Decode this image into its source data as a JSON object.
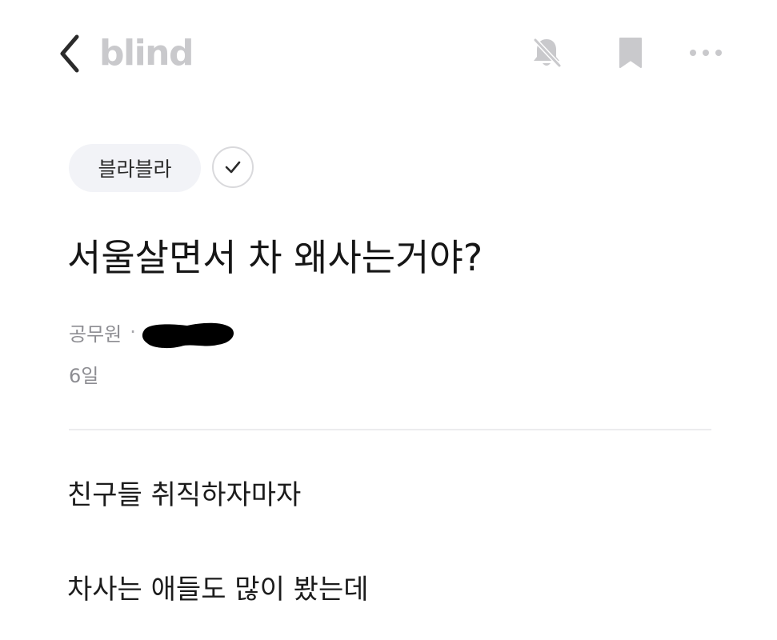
{
  "header": {
    "brand": "blind",
    "icons": {
      "back": "chevron-left-icon",
      "notifications": "bell-off-icon",
      "bookmark": "bookmark-icon",
      "more": "more-horizontal-icon"
    },
    "icon_color": "#c9c9cc"
  },
  "post": {
    "category": "블라블라",
    "category_followed": true,
    "title": "서울살면서 차 왜사는거야?",
    "author": {
      "job": "공무원",
      "name_redacted": true
    },
    "time": "6일",
    "body_lines": [
      "친구들 취직하자마자",
      "차사는 애들도 많이 봤는데"
    ]
  },
  "colors": {
    "background": "#ffffff",
    "chip_bg": "#f2f3f7",
    "meta_text": "#8d8d92",
    "title_text": "#161616"
  }
}
